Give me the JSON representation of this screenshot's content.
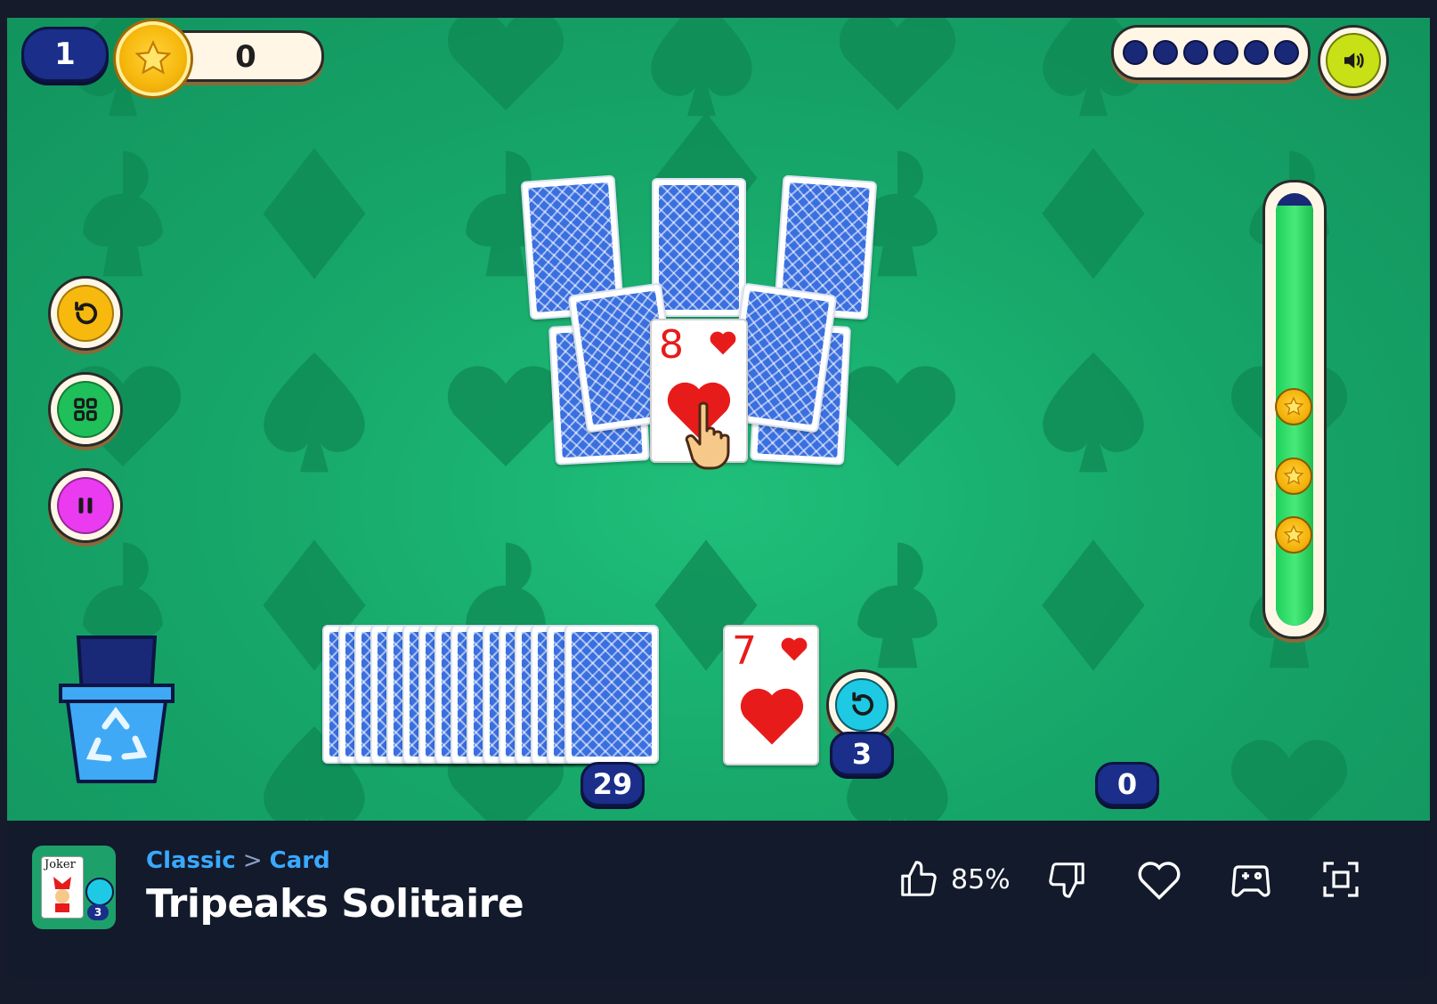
{
  "hud": {
    "level": "1",
    "coins": "0",
    "moves_dots": 6
  },
  "colors": {
    "felt": "#17a86a",
    "pill_blue": "#1a2e8a",
    "hearts": "#e81b1b",
    "card_back": "#3a6fe0",
    "link_blue": "#3ba8ff"
  },
  "side_buttons": [
    {
      "name": "restart-icon",
      "color": "#f7b90e"
    },
    {
      "name": "grid-icon",
      "color": "#1fbf5a"
    },
    {
      "name": "pause-icon",
      "color": "#ea3bf0"
    }
  ],
  "tableau": {
    "face_card": {
      "rank": "8",
      "suit": "heart"
    }
  },
  "stock": {
    "count": "29"
  },
  "waste": {
    "card": {
      "rank": "7",
      "suit": "heart"
    },
    "undo_count": "3"
  },
  "streak": {
    "count": "0"
  },
  "progress": {
    "stars": 3
  },
  "info": {
    "breadcrumb": [
      "Classic",
      "Card"
    ],
    "breadcrumb_sep": ">",
    "title": "Tripeaks Solitaire",
    "like_percent": "85%",
    "thumb_label": "Joker",
    "thumb_badge": "3"
  }
}
